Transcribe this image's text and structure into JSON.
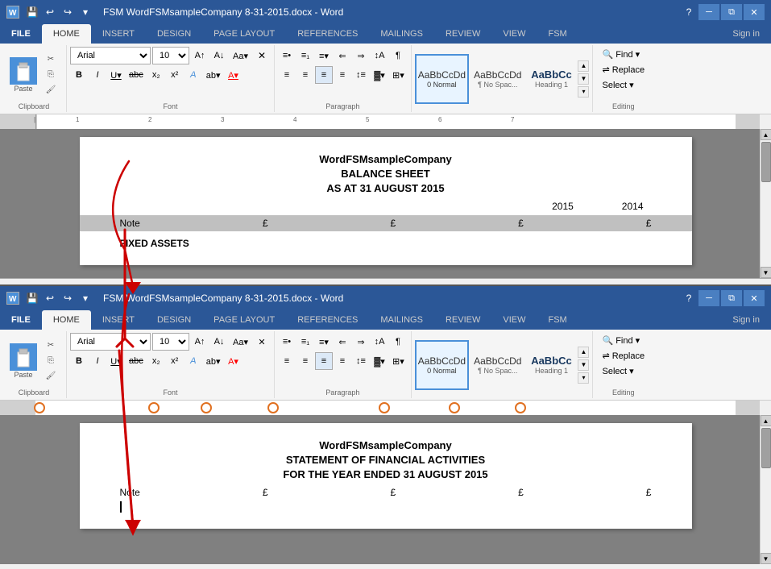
{
  "window1": {
    "title": "FSM WordFSMsampleCompany 8-31-2015.docx - Word",
    "tabs": [
      "FILE",
      "HOME",
      "INSERT",
      "DESIGN",
      "PAGE LAYOUT",
      "REFERENCES",
      "MAILINGS",
      "REVIEW",
      "VIEW",
      "FSM"
    ],
    "active_tab": "HOME",
    "sign_in": "Sign in",
    "font": "Arial",
    "font_size": "10",
    "styles": [
      {
        "label": "¶ Normal",
        "preview": "AaBbCcDd",
        "selected": true
      },
      {
        "label": "¶ No Spac...",
        "preview": "AaBbCcDd",
        "selected": false
      },
      {
        "label": "Heading 1",
        "preview": "AaBbCc",
        "selected": false
      }
    ],
    "editing": {
      "find": "Find",
      "replace": "Replace",
      "select": "Select"
    },
    "doc": {
      "company": "WordFSMsampleCompany",
      "title": "BALANCE SHEET",
      "subtitle": "AS AT 31 AUGUST 2015",
      "year1": "2015",
      "year2": "2014",
      "col_note": "Note",
      "col_pound1": "£",
      "col_pound2": "£",
      "col_pound3": "£",
      "col_pound4": "£",
      "section": "FIXED ASSETS"
    }
  },
  "window2": {
    "title": "FSM WordFSMsampleCompany 8-31-2015.docx - Word",
    "tabs": [
      "FILE",
      "HOME",
      "INSERT",
      "DESIGN",
      "PAGE LAYOUT",
      "REFERENCES",
      "MAILINGS",
      "REVIEW",
      "VIEW",
      "FSM"
    ],
    "active_tab": "HOME",
    "sign_in": "Sign in",
    "font": "Arial",
    "font_size": "10",
    "doc": {
      "company": "WordFSMsampleCompany",
      "title": "STATEMENT OF FINANCIAL ACTIVITIES",
      "subtitle": "FOR THE YEAR ENDED 31 AUGUST 2015",
      "col_note": "Note",
      "col_pound1": "£",
      "col_pound2": "£",
      "col_pound3": "£",
      "col_pound4": "£"
    }
  },
  "styles_box": {
    "normal": "0 Normal",
    "normal_preview": "AaBbCcDd",
    "no_space": "¶ No Spac...",
    "no_space_preview": "AaBbCcDd",
    "heading1": "Heading 1",
    "heading1_preview": "AaBbCc"
  }
}
